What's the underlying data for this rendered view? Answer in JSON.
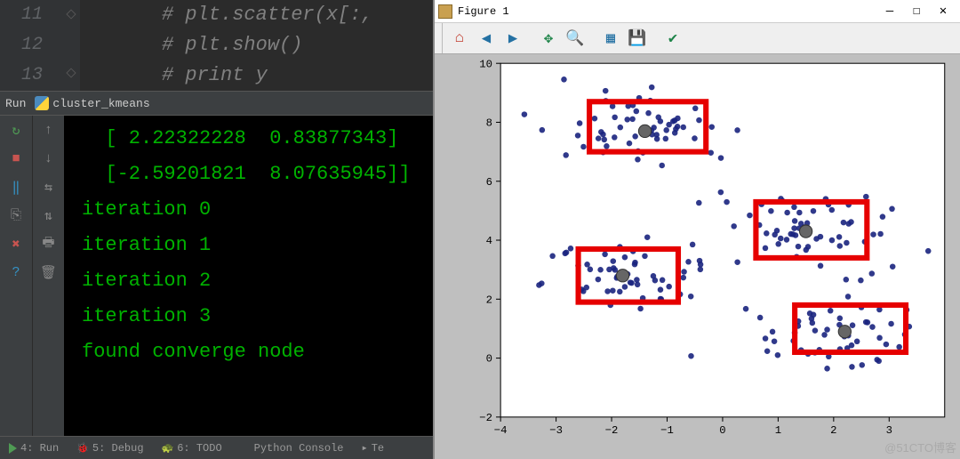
{
  "editor": {
    "lines": [
      {
        "num": "11",
        "text": "# plt.scatter(x[:,"
      },
      {
        "num": "12",
        "text": "# plt.show()"
      },
      {
        "num": "13",
        "text": "# print y"
      }
    ]
  },
  "run": {
    "label": "Run",
    "script": "cluster_kmeans"
  },
  "left_tool_icons": [
    "↻",
    "■",
    "‖",
    "⎘",
    "✖",
    "?"
  ],
  "left_tool_colors": [
    "#4f9b54",
    "#c75450",
    "#3592c4",
    "#888",
    "#c75450",
    "#3592c4"
  ],
  "left_tool_names": [
    "rerun-icon",
    "stop-icon",
    "pause-icon",
    "layout-icon",
    "close-icon",
    "help-icon"
  ],
  "right_tool_icons": [
    "↑",
    "↓",
    "⇆",
    "⇅",
    "🖶",
    "🗑"
  ],
  "right_tool_names": [
    "up-icon",
    "down-icon",
    "swap-icon",
    "softwrap-icon",
    "print-icon",
    "trash-icon"
  ],
  "console": {
    "lines": [
      "  [ 2.22322228  0.83877343]",
      "  [-2.59201821  8.07635945]]",
      "iteration 0",
      "iteration 1",
      "iteration 2",
      "iteration 3",
      "found converge node"
    ]
  },
  "statusbar": {
    "items": [
      "4: Run",
      "5: Debug",
      "6: TODO",
      "Python Console",
      "Te"
    ]
  },
  "figure": {
    "title": "Figure 1",
    "controls": {
      "min": "—",
      "max": "☐",
      "close": "✕"
    },
    "toolbar_icons": [
      "home",
      "back",
      "forward",
      "pan",
      "zoom",
      "subplots",
      "save",
      "ok"
    ],
    "toolbar_glyphs": [
      "⌂",
      "◀",
      "▶",
      "✥",
      "🔍",
      "▦",
      "💾",
      "✔"
    ]
  },
  "watermark": "@51CTO博客",
  "chart_data": {
    "type": "scatter",
    "xlim": [
      -4,
      4
    ],
    "ylim": [
      -2,
      10
    ],
    "xticks": [
      -4,
      -3,
      -2,
      -1,
      0,
      1,
      2,
      3
    ],
    "yticks": [
      -2,
      0,
      2,
      4,
      6,
      8,
      10
    ],
    "series": [
      {
        "name": "points",
        "color": "#1a237e",
        "marker": "o",
        "size": 5,
        "clusters": [
          {
            "cx": -1.4,
            "cy": 7.8,
            "n": 60,
            "sx": 0.8,
            "sy": 0.6
          },
          {
            "cx": 1.5,
            "cy": 4.3,
            "n": 60,
            "sx": 0.9,
            "sy": 0.7
          },
          {
            "cx": -1.8,
            "cy": 2.8,
            "n": 55,
            "sx": 0.7,
            "sy": 0.6
          },
          {
            "cx": 2.2,
            "cy": 0.9,
            "n": 55,
            "sx": 0.9,
            "sy": 0.6
          }
        ]
      },
      {
        "name": "centroids",
        "color": "#555",
        "marker": "o",
        "size": 11,
        "points": [
          [
            -1.4,
            7.7
          ],
          [
            1.5,
            4.3
          ],
          [
            -1.8,
            2.8
          ],
          [
            2.2,
            0.9
          ]
        ]
      }
    ],
    "boxes": [
      {
        "x0": -2.4,
        "y0": 7.0,
        "x1": -0.3,
        "y1": 8.7
      },
      {
        "x0": 0.6,
        "y0": 3.4,
        "x1": 2.6,
        "y1": 5.3
      },
      {
        "x0": -2.6,
        "y0": 1.9,
        "x1": -0.8,
        "y1": 3.7
      },
      {
        "x0": 1.3,
        "y0": 0.2,
        "x1": 3.3,
        "y1": 1.8
      }
    ]
  }
}
